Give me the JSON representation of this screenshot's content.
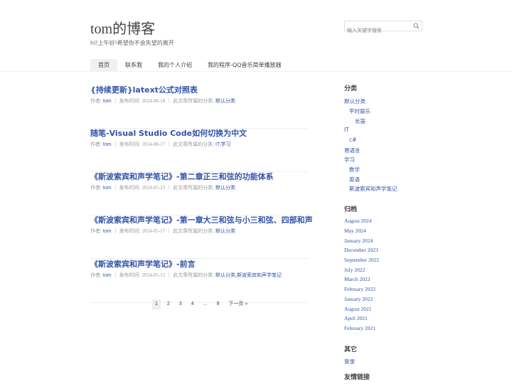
{
  "site": {
    "title": "tom的博客",
    "description": "hi!上午好!希望你不会失望的离开"
  },
  "search": {
    "placeholder": "输入关键字搜索",
    "value": ""
  },
  "nav": [
    {
      "label": "首页",
      "active": true
    },
    {
      "label": "联系我",
      "active": false
    },
    {
      "label": "我的个人介绍",
      "active": false
    },
    {
      "label": "我的程序-QQ音乐简单播放器",
      "active": false
    }
  ],
  "meta_labels": {
    "author": "作者: ",
    "published": "发布时间: ",
    "category": "此文章所属的分类: "
  },
  "posts": [
    {
      "title": "{持续更新}latext公式对照表",
      "author": "tom",
      "date": "2024-08-18",
      "category": "默认分类"
    },
    {
      "title": "随笔-Visual Studio Code如何切换为中文",
      "author": "tom",
      "date": "2024-08-17",
      "category": "IT,学习"
    },
    {
      "title": "《斯波索宾和声学笔记》-第二章正三和弦的功能体系",
      "author": "tom",
      "date": "2024-05-23",
      "category": "默认分类"
    },
    {
      "title": "《斯波索宾和声学笔记》-第一章大三和弦与小三和弦、四部和声",
      "author": "tom",
      "date": "2024-05-17",
      "category": "默认分类"
    },
    {
      "title": "《斯波索宾和声学笔记》-前言",
      "author": "tom",
      "date": "2024-05-15",
      "category": "默认分类,斯波索宾和声学笔记"
    }
  ],
  "pagination": {
    "pages": [
      "1",
      "2",
      "3",
      "4"
    ],
    "ellipsis": "...",
    "last": "9",
    "next": "下一页 »"
  },
  "sidebar": {
    "categories_title": "分类",
    "categories": [
      "默认分类",
      "平时娱乐",
      "长笛",
      "IT",
      "c#",
      "易语言",
      "学习",
      "数学",
      "英语",
      "斯波索宾和声学笔记"
    ],
    "archives_title": "归档",
    "archives": [
      "August 2024",
      "May 2024",
      "January 2024",
      "December 2023",
      "September 2022",
      "July 2022",
      "March 2022",
      "February 2022",
      "January 2022",
      "August 2021",
      "April 2021",
      "February 2021"
    ],
    "other_title": "其它",
    "other": [
      "登录"
    ],
    "links_title": "友情链接"
  }
}
